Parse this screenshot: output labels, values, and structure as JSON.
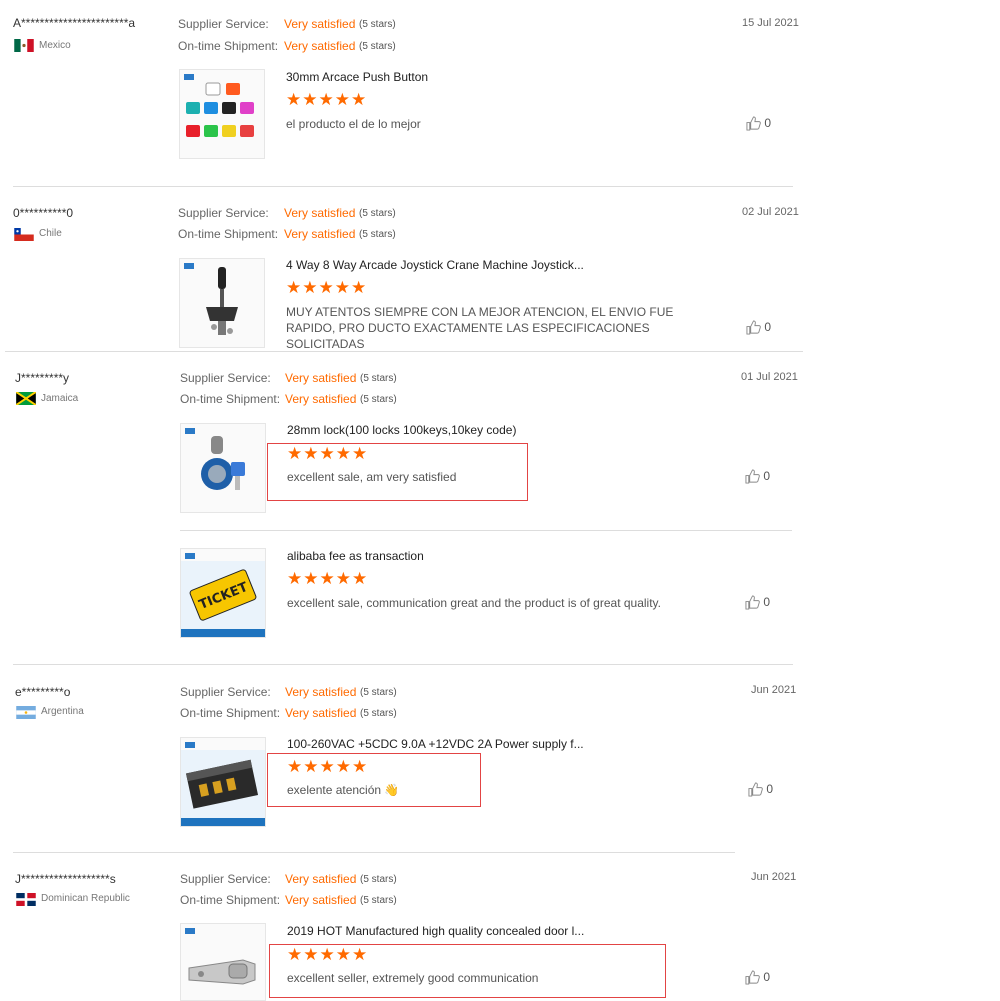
{
  "labels": {
    "supplier_service": "Supplier Service:",
    "ontime_shipment": "On-time Shipment:",
    "rating_text": "Very satisfied",
    "stars_note": "(5 stars)"
  },
  "colors": {
    "accent": "#ff6a00",
    "highlight_border": "#e24444",
    "divider": "#dddddd"
  },
  "reviews": [
    {
      "buyer": "A***********************a",
      "country": "Mexico",
      "date": "15 Jul 2021",
      "items": [
        {
          "title": "30mm Arcace Push Button",
          "stars": 5,
          "comment": "el producto el de lo mejor",
          "likes": "0"
        }
      ]
    },
    {
      "buyer": "0**********0",
      "country": "Chile",
      "date": "02 Jul 2021",
      "items": [
        {
          "title": "4 Way 8 Way Arcade Joystick Crane Machine Joystick...",
          "stars": 5,
          "comment": "MUY ATENTOS SIEMPRE CON LA MEJOR ATENCION, EL ENVIO FUE RAPIDO, PRO DUCTO EXACTAMENTE LAS ESPECIFICACIONES SOLICITADAS",
          "likes": "0"
        }
      ]
    },
    {
      "buyer": "J*********y",
      "country": "Jamaica",
      "date": "01 Jul 2021",
      "items": [
        {
          "title": "28mm lock(100 locks 100keys,10key code)",
          "stars": 5,
          "comment": "excellent sale, am very satisfied",
          "likes": "0"
        },
        {
          "title": "alibaba fee as transaction",
          "stars": 5,
          "comment": "excellent sale, communication great and the product is of great quality.",
          "likes": "0"
        }
      ]
    },
    {
      "buyer": "e*********o",
      "country": "Argentina",
      "date": "Jun 2021",
      "items": [
        {
          "title": "100-260VAC +5CDC 9.0A +12VDC 2A Power supply f...",
          "stars": 5,
          "comment": "exelente atención 👋",
          "likes": "0"
        }
      ]
    },
    {
      "buyer": "J*******************s",
      "country": "Dominican Republic",
      "date": "Jun 2021",
      "items": [
        {
          "title": "2019 HOT Manufactured high quality concealed door l...",
          "stars": 5,
          "comment": "excellent seller, extremely good communication",
          "likes": "0"
        }
      ]
    }
  ]
}
